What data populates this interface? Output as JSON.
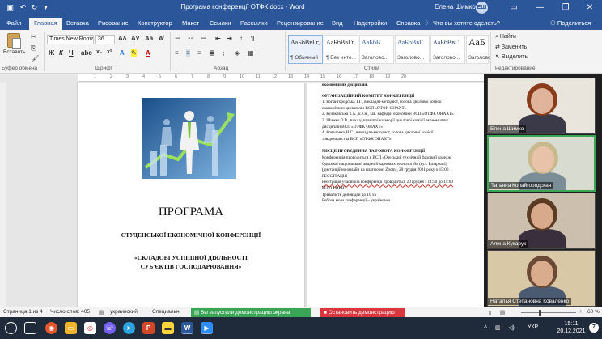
{
  "titlebar": {
    "doc_title": "Програма конференції ОТФК.docx  -  Word",
    "user_name": "Елена Шимко",
    "user_initials": "ЕШ"
  },
  "tabs": [
    "Файл",
    "Главная",
    "Вставка",
    "Рисование",
    "Конструктор",
    "Макет",
    "Ссылки",
    "Рассылки",
    "Рецензирование",
    "Вид",
    "Надстройки",
    "Справка",
    "Что вы хотите сделать?"
  ],
  "active_tab": "Главная",
  "share_label": "Поделиться",
  "ribbon": {
    "paste_label": "Вставить",
    "clipboard_label": "Буфер обмена",
    "font_label": "Шрифт",
    "paragraph_label": "Абзац",
    "styles_label": "Стили",
    "editing_label": "Редактирование",
    "font_name": "Times New Roma",
    "font_size": "36",
    "styles": [
      {
        "preview": "АаБбВвГг,",
        "name": "¶ Обычный"
      },
      {
        "preview": "АаБбВвГг,",
        "name": "¶ Без инте..."
      },
      {
        "preview": "АаБбВ",
        "name": "Заголово..."
      },
      {
        "preview": "АаБбВвГ",
        "name": "Заголово..."
      },
      {
        "preview": "АаБбВвГ",
        "name": "Заголово..."
      },
      {
        "preview": "АаБ",
        "name": "Заголово..."
      }
    ],
    "find_label": "Найти",
    "replace_label": "Заменить",
    "select_label": "Выделить"
  },
  "page1": {
    "title": "ПРОГРАМА",
    "subtitle": "СТУДЕНСЬКОЇ ЕКОНОМІЧНОЇ КОНФЕРЕНЦІЇ",
    "theme_line1": "«СКЛАДОВІ УСПІШНОЇ ДІЯЛЬНОСТІ",
    "theme_line2": "СУБ'ЄКТІВ ГОСПОДАРЮВАННЯ»"
  },
  "page2": {
    "lines": [
      {
        "text": "економічних дисциплін.",
        "style": "bold"
      },
      {
        "text": "ОРГАНІЗАЦІЙНИЙ КОМІТЕТ КОНФЕРЕНЦІЇ",
        "style": "bold"
      },
      {
        "text": "1. Копайгородська Т.Г., викладач-методист, голова циклової комісії",
        "style": ""
      },
      {
        "text": "економічних дисциплін ВСП «ОТФК ОНАХТ»",
        "style": ""
      },
      {
        "text": "2. Кулаковська Т.А., к.е.н., зав. кафедри економіки ВСП «ОТФК ОНАХТ»",
        "style": ""
      },
      {
        "text": "3. Шимко О.В., викладач вищої категорії циклової комісії економічних",
        "style": ""
      },
      {
        "text": "дисциплін ВСП «ОТФК ОНАХТ»",
        "style": ""
      },
      {
        "text": "4. Коваленко Н.С., викладач-методист, голова циклової комісії",
        "style": ""
      },
      {
        "text": "товарознавства ВСП «ОТФК ОНАХТ»",
        "style": ""
      },
      {
        "text": "МІСЦЕ ПРОВЕДЕННЯ ТА РОБОТА КОНФЕРЕНЦІЇ",
        "style": "bold"
      },
      {
        "text": "Конференція проводиться в ВСП «Одеський технічний фаховий коледж",
        "style": ""
      },
      {
        "text": "Одеської національної академії харчових технологій» (вул. Базарна 4)",
        "style": ""
      },
      {
        "text": "(дистанційно онлайн на платформі Zoom), 20 грудня 2021 року о 15:00",
        "style": ""
      },
      {
        "text": "РЕЄСТРАЦІЯ",
        "style": ""
      },
      {
        "text": "Реєстрація учасників конференції проводиться 20 грудня з 14:50 до 15:00",
        "style": "under"
      },
      {
        "text": "РЕГЛАМЕНТ",
        "style": ""
      },
      {
        "text": "Тривалість доповідей до 10 хв",
        "style": ""
      },
      {
        "text": "Робоча мова конференції – українська.",
        "style": ""
      }
    ]
  },
  "participants": [
    {
      "name": "Елена Шимко",
      "speaking": false,
      "bg": "#e9e4dc",
      "hair": "#8a3b1a",
      "skin": "#e0b49a",
      "shirt": "#3a3a48"
    },
    {
      "name": "Татьяна Копайгородская",
      "speaking": true,
      "bg": "#d7dbd0",
      "hair": "#c9b98f",
      "skin": "#e8c3a9",
      "shirt": "#7b8d97"
    },
    {
      "name": "Алина Кукарук",
      "speaking": false,
      "bg": "#cdbfae",
      "hair": "#5a3b24",
      "skin": "#d8a98a",
      "shirt": "#3a2f3d"
    },
    {
      "name": "Наталья Степановна Коваленко",
      "speaking": false,
      "bg": "#d8c8a5",
      "hair": "#6b4a35",
      "skin": "#d9ac8e",
      "shirt": "#4a5a70"
    }
  ],
  "statusbar": {
    "page": "Страница 1 из 4",
    "words": "Число слов: 405",
    "lang": "украинский",
    "special": "Специальн",
    "share_msg": "Вы запустили демонстрацию экрана",
    "stop_label": "Остановить демонстрацию",
    "zoom": "60 %"
  },
  "taskbar": {
    "time": "15:11",
    "date": "20.12.2021",
    "lang": "УКР",
    "notif_count": "7"
  }
}
